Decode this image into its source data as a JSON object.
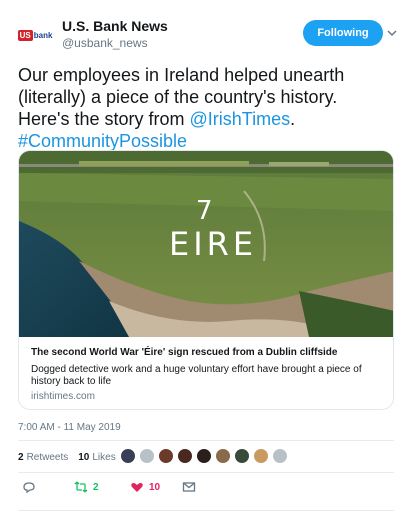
{
  "header": {
    "account_name": "U.S. Bank News",
    "handle": "@usbank_news",
    "logo_us": "US",
    "logo_bank": "bank",
    "follow_label": "Following",
    "accent_color": "#1da1f2"
  },
  "tweet": {
    "text_before": "Our employees in Ireland helped unearth (literally) a piece of the country's history. Here's the story from ",
    "mention": "@IrishTimes",
    "text_after": ".",
    "hashtag": "#CommunityPossible"
  },
  "card": {
    "image_text_7": "7",
    "image_text_eire": "EIRE",
    "title": "The second World War 'Éire' sign rescued from a Dublin cliffside",
    "description": "Dogged detective work and a huge voluntary effort have brought a piece of history back to life",
    "domain": "irishtimes.com"
  },
  "timestamp": "7:00 AM - 11 May 2019",
  "stats": {
    "retweets_count": "2",
    "retweets_label": "Retweets",
    "likes_count": "10",
    "likes_label": "Likes"
  },
  "actions": {
    "reply_icon": "reply-icon",
    "retweet_count": "2",
    "like_count": "10",
    "retweet_color": "#17bf63",
    "like_color": "#e0245e"
  }
}
